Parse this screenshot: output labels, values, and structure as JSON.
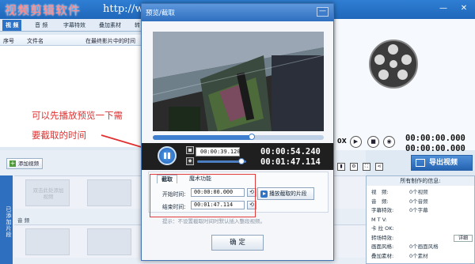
{
  "app": {
    "watermark_title": "视频剪辑软件",
    "watermark_url": "http://ww",
    "tabs": [
      "视 频",
      "音 频",
      "字幕特效",
      "叠加素材",
      "转"
    ],
    "columns": [
      "序号",
      "文件名",
      "在最终影片中的时间"
    ]
  },
  "annotation": {
    "line1": "可以先播放预览一下需",
    "line2": "要截取的时间"
  },
  "dialog": {
    "title": "预览/截取",
    "current_time": "00:00:39.120",
    "total_time_top": "00:00:54.240",
    "total_time_bottom": "00:01:47.114",
    "progress": 0.58,
    "volume": 0.9,
    "tabs": [
      "截取",
      "魔术功能"
    ],
    "start_label": "开始时间:",
    "start_value": "00:00:00.000",
    "end_label": "结束时间:",
    "end_value": "00:01:47.114",
    "play_clip_label": "播放截取的片段",
    "hint": "提示：不设置截取时间时默认插入整段视频。",
    "ok_label": "确 定"
  },
  "timeline": {
    "add_video_label": "添加视频",
    "side_tab": "已添加片段",
    "empty_slot_text": "双击此处添加视频",
    "audio_track_label": "音 频"
  },
  "preview": {
    "time_top": "00:00:00.000",
    "time_bottom": "00:00:00.000",
    "time_side": "0X",
    "export_label": "导出视频"
  },
  "info": {
    "title": "所有制作的信息:",
    "rows": [
      {
        "k": "视　频:",
        "v": "0个视频"
      },
      {
        "k": "音　频:",
        "v": "0个音频"
      },
      {
        "k": "字幕特效:",
        "v": "0个字幕"
      },
      {
        "k": "M  T  V:",
        "v": ""
      },
      {
        "k": "卡 拉 OK:",
        "v": ""
      },
      {
        "k": "转场特效:",
        "v": "",
        "highlight": true
      },
      {
        "k": "画面风格:",
        "v": "0个画面风格"
      },
      {
        "k": "叠加素材:",
        "v": "0个素材"
      }
    ],
    "detail_label": "详细"
  },
  "colors": {
    "titlebar": "#2f7fd4",
    "accent": "#2f73c6",
    "annotation_red": "#e03030"
  }
}
